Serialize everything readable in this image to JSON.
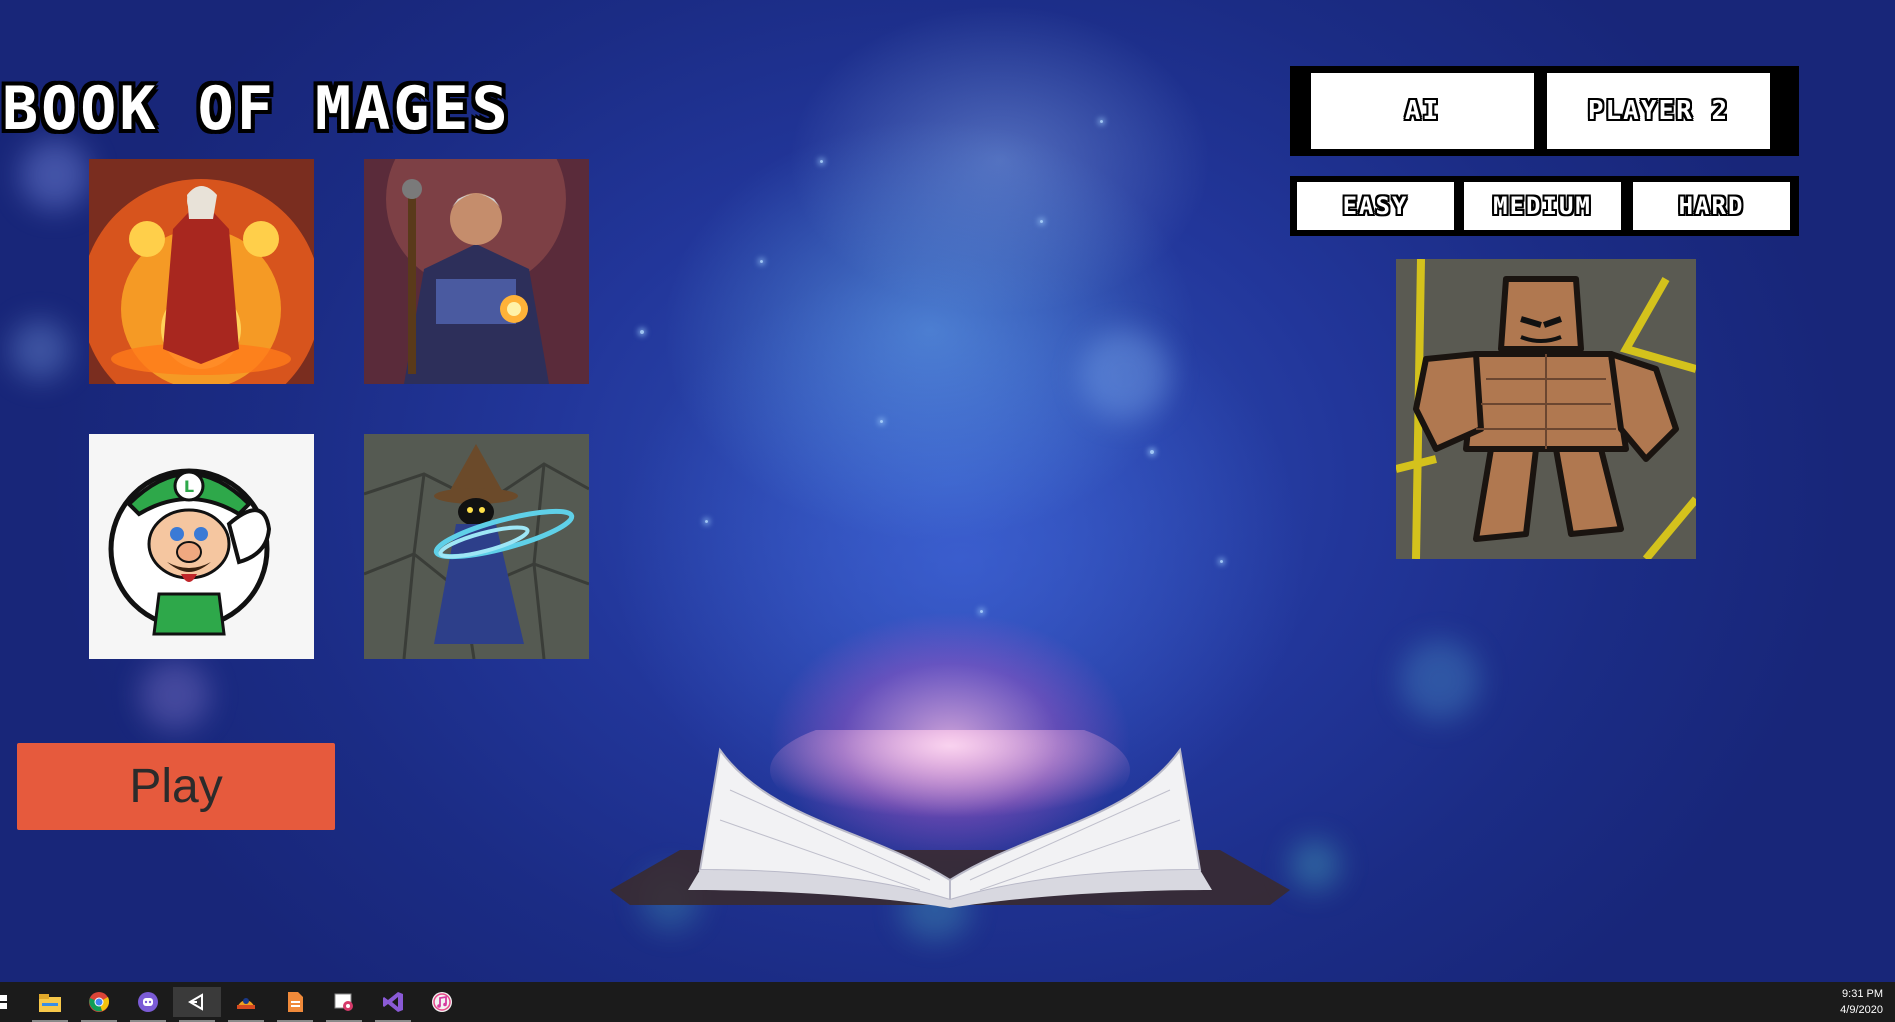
{
  "title": "BOOK OF MAGES",
  "characters": [
    {
      "name": "fire-sorceress-portrait"
    },
    {
      "name": "staff-mage-portrait"
    },
    {
      "name": "luigi-portrait"
    },
    {
      "name": "black-mage-portrait"
    }
  ],
  "play_label": "Play",
  "mode": {
    "options": [
      "AI",
      "PLAYER 2"
    ]
  },
  "difficulty": {
    "options": [
      "EASY",
      "MEDIUM",
      "HARD"
    ]
  },
  "opponent": {
    "name": "golem-portrait"
  },
  "taskbar": {
    "icons": [
      "file-explorer-icon",
      "chrome-icon",
      "discord-icon",
      "unity-icon",
      "gitkraken-icon",
      "document-icon",
      "snipping-tool-icon",
      "visual-studio-icon",
      "itunes-icon"
    ],
    "time": "9:31 PM",
    "date": "4/9/2020"
  },
  "colors": {
    "play_button": "#e65a3d",
    "background": "#1c2a78",
    "taskbar": "#1b1b1b"
  }
}
